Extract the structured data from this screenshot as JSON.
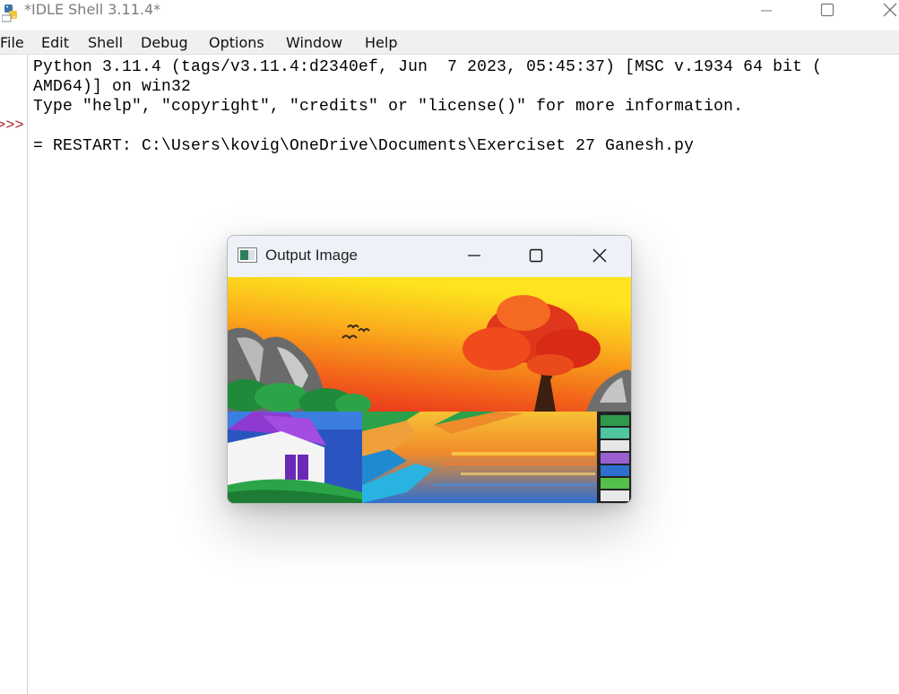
{
  "window": {
    "title": "*IDLE Shell 3.11.4*",
    "icon": "python-logo-icon",
    "controls": [
      "minimize-icon",
      "maximize-icon",
      "close-icon"
    ]
  },
  "menu": [
    "File",
    "Edit",
    "Shell",
    "Debug",
    "Options",
    "Window",
    "Help"
  ],
  "shell": {
    "prompt": ">>>",
    "lines": [
      "Python 3.11.4 (tags/v3.11.4:d2340ef, Jun  7 2023, 05:45:37) [MSC v.1934 64 bit (",
      "AMD64)] on win32",
      "Type \"help\", \"copyright\", \"credits\" or \"license()\" for more information.",
      "",
      "= RESTART: C:\\Users\\kovig\\OneDrive\\Documents\\Exerciset 27 Ganesh.py"
    ]
  },
  "output_window": {
    "title": "Output Image",
    "icon": "image-window-icon",
    "image": "colorful-landscape-painting"
  },
  "colors": {
    "prompt": "#a52a2a",
    "menubar": "#f0f0f0",
    "output_titlebar": "#eef1f8"
  }
}
